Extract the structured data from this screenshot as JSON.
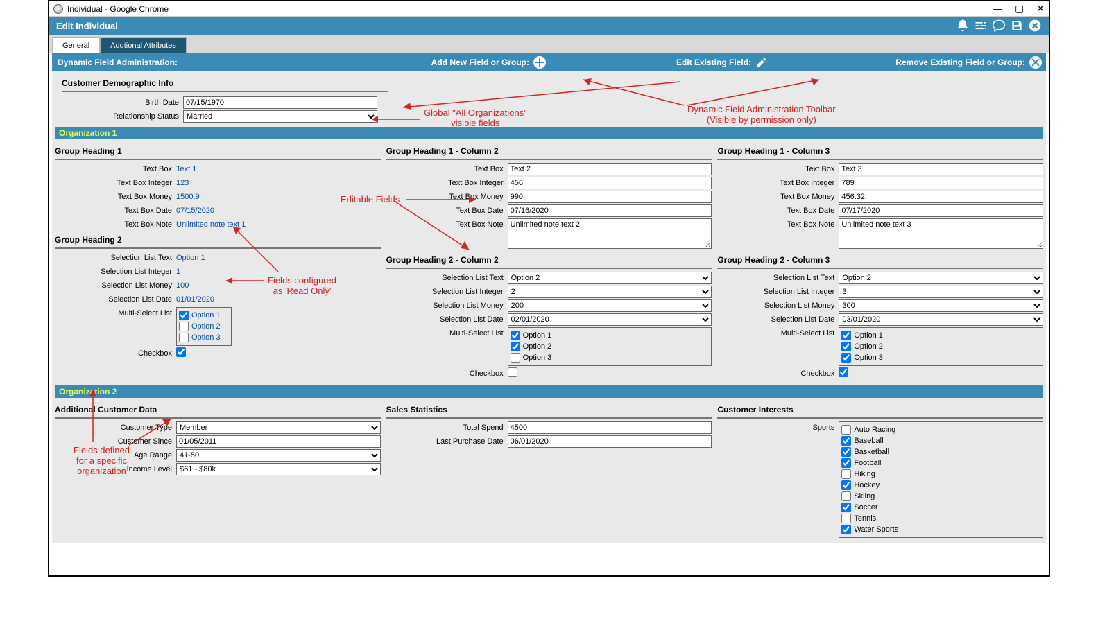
{
  "window": {
    "title": "Individual - Google Chrome"
  },
  "header": {
    "title": "Edit Individual"
  },
  "tabs": {
    "general": "General",
    "additional": "Addtional Attributes"
  },
  "adminbar": {
    "label": "Dynamic Field Administration:",
    "add": "Add New Field or Group:",
    "edit": "Edit Existing Field:",
    "remove": "Remove Existing Field or Group:"
  },
  "demographics": {
    "heading": "Customer Demographic Info",
    "birth_label": "Birth Date",
    "birth_value": "07/15/1970",
    "rel_label": "Relationship Status",
    "rel_value": "Married"
  },
  "org1": {
    "title": "Organization 1",
    "col1": {
      "g1": "Group Heading 1",
      "tb_l": "Text Box",
      "tb_v": "Text 1",
      "tbi_l": "Text Box Integer",
      "tbi_v": "123",
      "tbm_l": "Text Box Money",
      "tbm_v": "1500.9",
      "tbd_l": "Text Box Date",
      "tbd_v": "07/15/2020",
      "tbn_l": "Text Box Note",
      "tbn_v": "Unlimited note text 1",
      "g2": "Group Heading 2",
      "slt_l": "Selection List Text",
      "slt_v": "Option 1",
      "sli_l": "Selection List Integer",
      "sli_v": "1",
      "slm_l": "Selection List Money",
      "slm_v": "100",
      "sld_l": "Selection List Date",
      "sld_v": "01/01/2020",
      "ms_l": "Multi-Select List",
      "opt1": "Option 1",
      "opt2": "Option 2",
      "opt3": "Option 3",
      "cb_l": "Checkbox"
    },
    "col2": {
      "g1": "Group Heading 1 - Column 2",
      "tb_l": "Text Box",
      "tb_v": "Text 2",
      "tbi_l": "Text Box Integer",
      "tbi_v": "456",
      "tbm_l": "Text Box Money",
      "tbm_v": "990",
      "tbd_l": "Text Box Date",
      "tbd_v": "07/16/2020",
      "tbn_l": "Text Box Note",
      "tbn_v": "Unlimited note text 2",
      "g2": "Group Heading 2 - Column 2",
      "slt_l": "Selection List Text",
      "slt_v": "Option 2",
      "sli_l": "Selection List Integer",
      "sli_v": "2",
      "slm_l": "Selection List Money",
      "slm_v": "200",
      "sld_l": "Selection List Date",
      "sld_v": "02/01/2020",
      "ms_l": "Multi-Select List",
      "opt1": "Option 1",
      "opt2": "Option 2",
      "opt3": "Option 3",
      "cb_l": "Checkbox"
    },
    "col3": {
      "g1": "Group Heading 1 - Column 3",
      "tb_l": "Text Box",
      "tb_v": "Text 3",
      "tbi_l": "Text Box Integer",
      "tbi_v": "789",
      "tbm_l": "Text Box Money",
      "tbm_v": "456.32",
      "tbd_l": "Text Box Date",
      "tbd_v": "07/17/2020",
      "tbn_l": "Text Box Note",
      "tbn_v": "Unlimited note text 3",
      "g2": "Group Heading 2 - Column 3",
      "slt_l": "Selection List Text",
      "slt_v": "Option 2",
      "sli_l": "Selection List Integer",
      "sli_v": "3",
      "slm_l": "Selection List Money",
      "slm_v": "300",
      "sld_l": "Selection List Date",
      "sld_v": "03/01/2020",
      "ms_l": "Multi-Select List",
      "opt1": "Option 1",
      "opt2": "Option 2",
      "opt3": "Option 3",
      "cb_l": "Checkbox"
    }
  },
  "org2": {
    "title": "Organization 2",
    "col1": {
      "heading": "Additional Customer Data",
      "ct_l": "Customer Type",
      "ct_v": "Member",
      "cs_l": "Customer Since",
      "cs_v": "01/05/2011",
      "ar_l": "Age Range",
      "ar_v": "41-50",
      "il_l": "Income Level",
      "il_v": "$61 - $80k"
    },
    "col2": {
      "heading": "Sales Statistics",
      "ts_l": "Total Spend",
      "ts_v": "4500",
      "lp_l": "Last Purchase Date",
      "lp_v": "06/01/2020"
    },
    "col3": {
      "heading": "Customer Interests",
      "sp_l": "Sports",
      "items": {
        "i0": "Auto Racing",
        "i1": "Baseball",
        "i2": "Basketball",
        "i3": "Football",
        "i4": "Hiking",
        "i5": "Hockey",
        "i6": "Skiing",
        "i7": "Soccer",
        "i8": "Tennis",
        "i9": "Water Sports"
      }
    }
  },
  "annotations": {
    "global": "Global \"All Organizations\"\nvisible fields",
    "dyntool": "Dynamic Field Administration Toolbar\n(Visible by permission only)",
    "editable": "Editable Fields",
    "readonly": "Fields configured\nas 'Read Only'",
    "orgspec": "Fields defined\nfor a specific\norganization"
  }
}
